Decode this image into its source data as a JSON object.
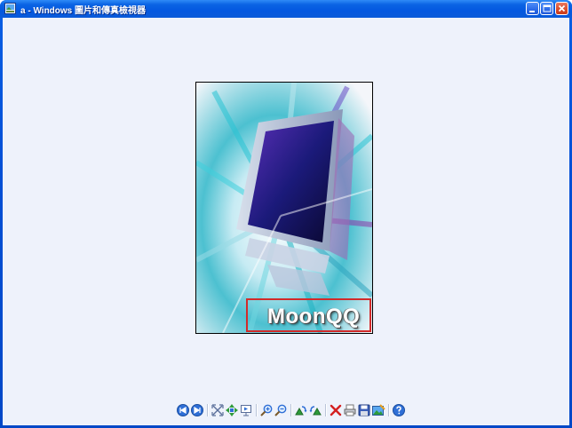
{
  "window": {
    "title": "a - Windows 圖片和傳真檢視器",
    "controls": {
      "minimize": "minimize",
      "maximize": "maximize",
      "close": "close"
    }
  },
  "image": {
    "watermark_text": "MoonQQ"
  },
  "toolbar": {
    "buttons": [
      {
        "name": "previous-image",
        "icon": "previous-icon"
      },
      {
        "name": "next-image",
        "icon": "next-icon"
      },
      {
        "name": "best-fit",
        "icon": "best-fit-icon"
      },
      {
        "name": "actual-size",
        "icon": "actual-size-icon"
      },
      {
        "name": "slideshow",
        "icon": "slideshow-icon"
      },
      {
        "name": "zoom-in",
        "icon": "zoom-in-icon"
      },
      {
        "name": "zoom-out",
        "icon": "zoom-out-icon"
      },
      {
        "name": "rotate-clockwise",
        "icon": "rotate-cw-icon"
      },
      {
        "name": "rotate-counterclockwise",
        "icon": "rotate-ccw-icon"
      },
      {
        "name": "delete",
        "icon": "delete-icon"
      },
      {
        "name": "print",
        "icon": "print-icon"
      },
      {
        "name": "save",
        "icon": "save-icon"
      },
      {
        "name": "edit",
        "icon": "edit-icon"
      },
      {
        "name": "help",
        "icon": "help-icon"
      }
    ]
  },
  "colors": {
    "titlebar": "#0458e0",
    "client_bg": "#eef2fb",
    "watermark_box": "#d22a2a",
    "icon_blue": "#2f6fd6",
    "icon_green": "#2e9b3a",
    "icon_red": "#d42020"
  }
}
